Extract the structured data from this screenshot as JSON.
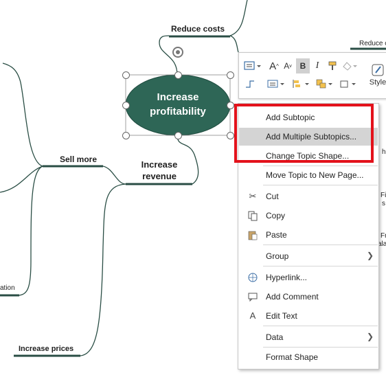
{
  "central_topic": {
    "line1": "Increase",
    "line2": "profitability",
    "fill": "#2e6656"
  },
  "topics": {
    "reduce_costs": "Reduce costs",
    "increase_revenue_1": "Increase",
    "increase_revenue_2": "revenue",
    "sell_more": "Sell more",
    "increase_prices": "Increase prices",
    "partial_ation": "ation",
    "partial_reduce": "Reduce c",
    "partial_fi": "Fi",
    "partial_s": "s",
    "partial_fr": "Fr",
    "partial_ala": "ala",
    "partial_h": "h"
  },
  "toolbar": {
    "bold": "B",
    "italic": "I",
    "styles": "Style"
  },
  "menu": {
    "add_subtopic": "Add Subtopic",
    "add_multiple_subtopics": "Add Multiple Subtopics...",
    "change_topic_shape": "Change Topic Shape...",
    "move_topic": "Move Topic to New Page...",
    "cut": "Cut",
    "copy": "Copy",
    "paste": "Paste",
    "group": "Group",
    "hyperlink": "Hyperlink...",
    "add_comment": "Add Comment",
    "edit_text": "Edit Text",
    "data": "Data",
    "format_shape": "Format Shape"
  },
  "colors": {
    "topic_fill": "#2e6656",
    "line": "#294d44",
    "highlight": "#e3121b",
    "menu_hover": "#d4d4d4"
  },
  "icons": [
    "rotate-handle-icon",
    "text-box-icon",
    "increase-font-icon",
    "decrease-font-icon",
    "bold-icon",
    "italic-icon",
    "format-painter-icon",
    "fill-icon",
    "shape-styles-icon",
    "connector-icon",
    "align-icon",
    "arrange-icon",
    "position-icon",
    "scissors-icon",
    "copy-icon",
    "paste-icon",
    "hyperlink-icon",
    "comment-icon",
    "edit-text-icon",
    "chevron-right-icon"
  ]
}
